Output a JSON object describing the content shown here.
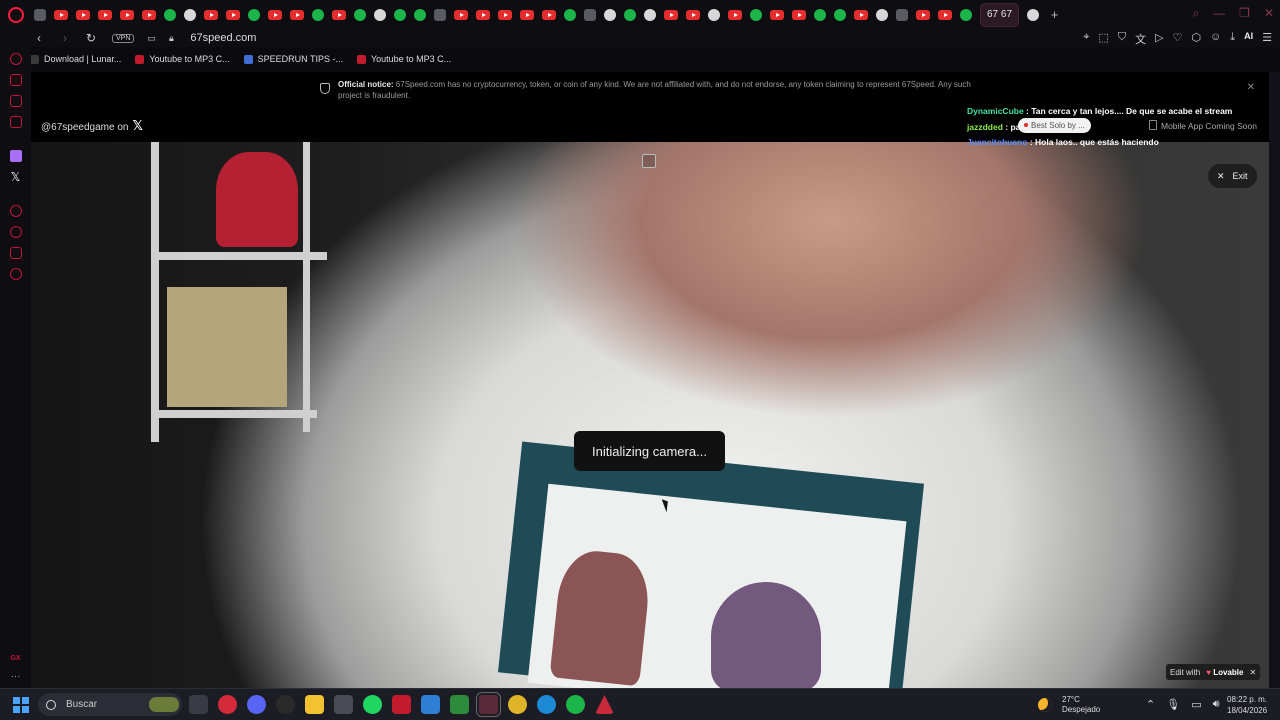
{
  "browser": {
    "active_tab_label": "67 67",
    "url": "67speed.com",
    "vpn_label": "VPN",
    "ai_label": "AI"
  },
  "bookmarks": [
    {
      "label": "Download | Lunar...",
      "color": "#3a3a3a"
    },
    {
      "label": "Youtube to MP3 C...",
      "color": "#c21b2d"
    },
    {
      "label": "SPEEDRUN TIPS -...",
      "color": "#3f6fd6"
    },
    {
      "label": "Youtube to MP3 C...",
      "color": "#c21b2d"
    }
  ],
  "notice": {
    "title": "Official notice:",
    "body": "67Speed.com has no cryptocurrency, token, or coin of any kind. We are not affiliated with, and do not endorse, any token claiming to represent 67Speed. Any such project is fraudulent."
  },
  "page": {
    "handle_text": "@67speedgame on",
    "mobile_text": "Mobile App Coming Soon",
    "status_text": "Initializing camera...",
    "exit_label": "Exit",
    "lovable_edit": "Edit with",
    "lovable_brand": "Lovable"
  },
  "chat": [
    {
      "user": "DynamicCube",
      "message": " : Tan cerca y tan lejos.... De que se acabe el stream"
    },
    {
      "user": "jazzdded",
      "message": " : pa... hear?"
    },
    {
      "user": "Juancitobueno",
      "message": " : Hola laos.. que estás haciendo"
    }
  ],
  "tooltip": "Best Solo by ...",
  "taskbar": {
    "search_placeholder": "Buscar",
    "weather_temp": "27°C",
    "weather_desc": "Despejado",
    "time": "08:22 p. m.",
    "date": "18/04/2026"
  },
  "colors": {
    "accent": "#c3163a",
    "youtube": "#e62c2c"
  }
}
